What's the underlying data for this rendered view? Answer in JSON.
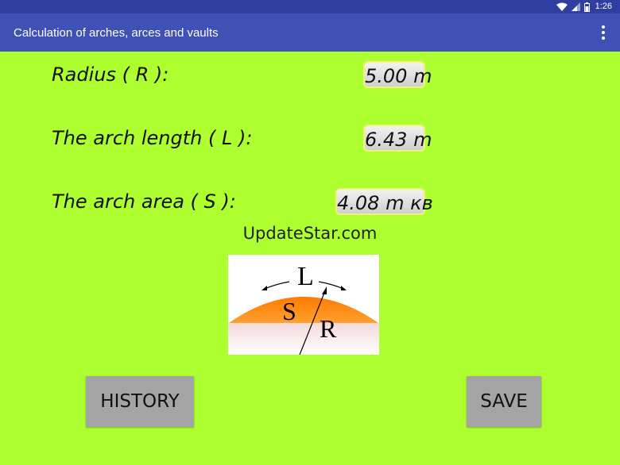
{
  "status_bar": {
    "time": "1:26"
  },
  "app_bar": {
    "title": "Calculation of arches, arces and vaults"
  },
  "fields": {
    "radius": {
      "label": "Radius ( R ):",
      "value": "5.00 m"
    },
    "length": {
      "label": "The arch length ( L ):",
      "value": "6.43 m"
    },
    "area": {
      "label": "The arch area ( S ):",
      "value": "4.08 m кв"
    }
  },
  "watermark": "UpdateStar.com",
  "diagram": {
    "label_l": "L",
    "label_s": "S",
    "label_r": "R"
  },
  "buttons": {
    "history": "HISTORY",
    "save": "SAVE"
  },
  "colors": {
    "background": "#adff2f",
    "app_bar": "#3f51b5",
    "status_bar": "#303f9f",
    "button": "#a4a4a4",
    "arch": "#ff8800"
  }
}
